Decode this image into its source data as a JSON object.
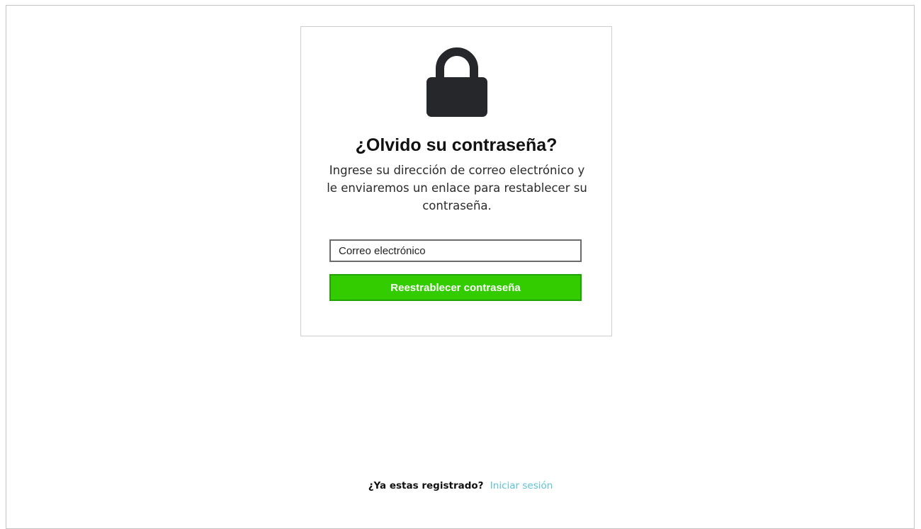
{
  "header": {
    "title": "¿Olvido su contraseña?",
    "description": "Ingrese su dirección de correo electrónico y le enviaremos un enlace para restablecer su contraseña."
  },
  "form": {
    "email_placeholder": "Correo electrónico",
    "email_value": "",
    "submit_label": "Reestrablecer contraseña"
  },
  "footer": {
    "question": "¿Ya estas registrado?",
    "login_label": "Iniciar sesión"
  },
  "icons": {
    "lock": "lock-icon"
  },
  "colors": {
    "button_bg": "#33cc00",
    "button_border": "#1fa300",
    "link": "#5bc4d6",
    "icon": "#25272b"
  }
}
